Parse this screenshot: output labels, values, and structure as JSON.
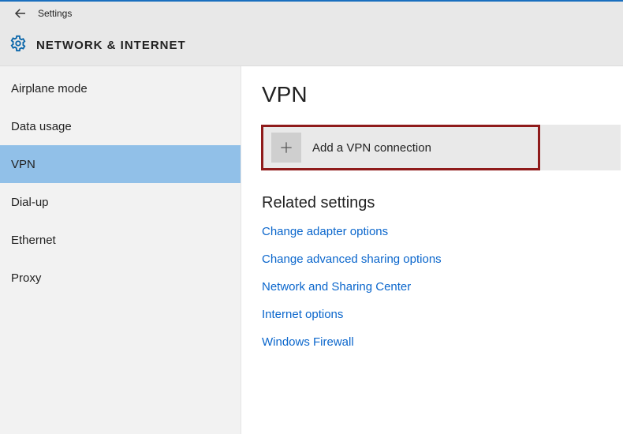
{
  "window": {
    "title": "Settings"
  },
  "category": {
    "title": "NETWORK & INTERNET"
  },
  "sidebar": {
    "items": [
      {
        "label": "Airplane mode",
        "key": "airplane-mode",
        "selected": false
      },
      {
        "label": "Data usage",
        "key": "data-usage",
        "selected": false
      },
      {
        "label": "VPN",
        "key": "vpn",
        "selected": true
      },
      {
        "label": "Dial-up",
        "key": "dial-up",
        "selected": false
      },
      {
        "label": "Ethernet",
        "key": "ethernet",
        "selected": false
      },
      {
        "label": "Proxy",
        "key": "proxy",
        "selected": false
      }
    ]
  },
  "main": {
    "page_title": "VPN",
    "add_button": {
      "label": "Add a VPN connection"
    },
    "related": {
      "title": "Related settings",
      "links": [
        {
          "label": "Change adapter options"
        },
        {
          "label": "Change advanced sharing options"
        },
        {
          "label": "Network and Sharing Center"
        },
        {
          "label": "Internet options"
        },
        {
          "label": "Windows Firewall"
        }
      ]
    }
  },
  "highlight": {
    "target": "add-vpn-button",
    "color": "#8f1b1b"
  }
}
